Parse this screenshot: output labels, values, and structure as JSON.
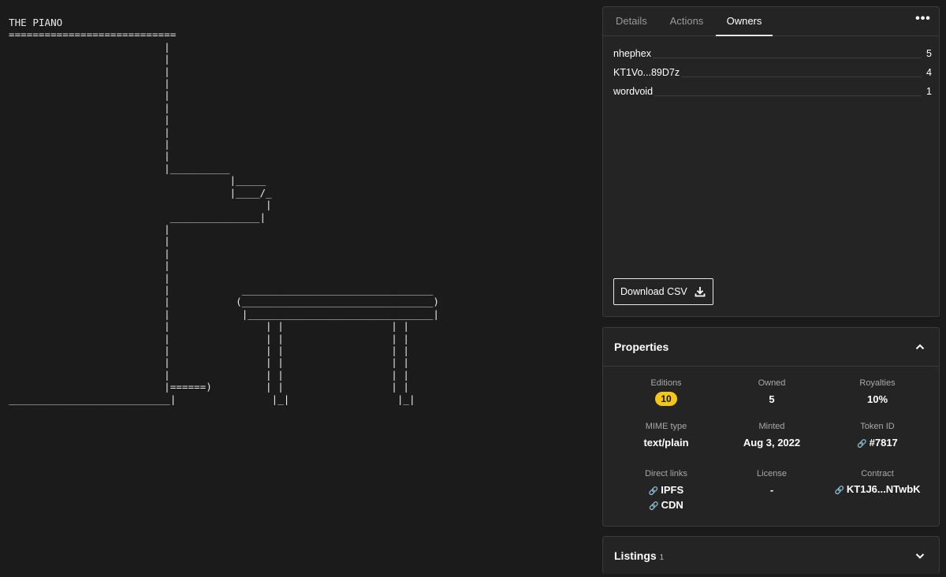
{
  "artwork": {
    "ascii_lines": [
      "THE PIANO",
      "============================",
      "                          |",
      "                          |",
      "                          |",
      "                          |",
      "                          |",
      "                          |",
      "                          |",
      "                          |",
      "                          |",
      "                          |",
      "                          |__________",
      "                                     |_____",
      "                                     |____/_",
      "                                           |",
      "                           _______________|",
      "                          |",
      "                          |",
      "                          |",
      "                          |",
      "                          |",
      "                          |            ________________________________",
      "                          |           (________________________________)",
      "                          |            |_______________________________|",
      "                          |                | |                  | |",
      "                          |                | |                  | |",
      "                          |                | |                  | |",
      "                          |                | |                  | |",
      "                          |                | |                  | |",
      "                          |======)         | |                  | |",
      "___________________________|                |_|                  |_|"
    ]
  },
  "tabs": [
    {
      "label": "Details",
      "active": false
    },
    {
      "label": "Actions",
      "active": false
    },
    {
      "label": "Owners",
      "active": true
    }
  ],
  "more_icon": "more-horizontal-icon",
  "owners": [
    {
      "name": "nhephex",
      "count": "5"
    },
    {
      "name": "KT1Vo...89D7z",
      "count": "4"
    },
    {
      "name": "wordvoid",
      "count": "1"
    }
  ],
  "download": {
    "label": "Download CSV",
    "icon": "download-icon"
  },
  "properties": {
    "title": "Properties",
    "editions_label": "Editions",
    "editions_value": "10",
    "owned_label": "Owned",
    "owned_value": "5",
    "royalties_label": "Royalties",
    "royalties_value": "10%",
    "mime_label": "MIME type",
    "mime_value": "text/plain",
    "minted_label": "Minted",
    "minted_value": "Aug 3, 2022",
    "token_label": "Token ID",
    "token_value": "#7817",
    "links_label": "Direct links",
    "link_ipfs": "IPFS",
    "link_cdn": "CDN",
    "license_label": "License",
    "license_value": "-",
    "contract_label": "Contract",
    "contract_value": "KT1J6...NTwbK"
  },
  "listings": {
    "title": "Listings",
    "count": "1"
  },
  "colors": {
    "badge": "#f5c518",
    "background": "#1b1b1b",
    "panel": "#242424"
  }
}
